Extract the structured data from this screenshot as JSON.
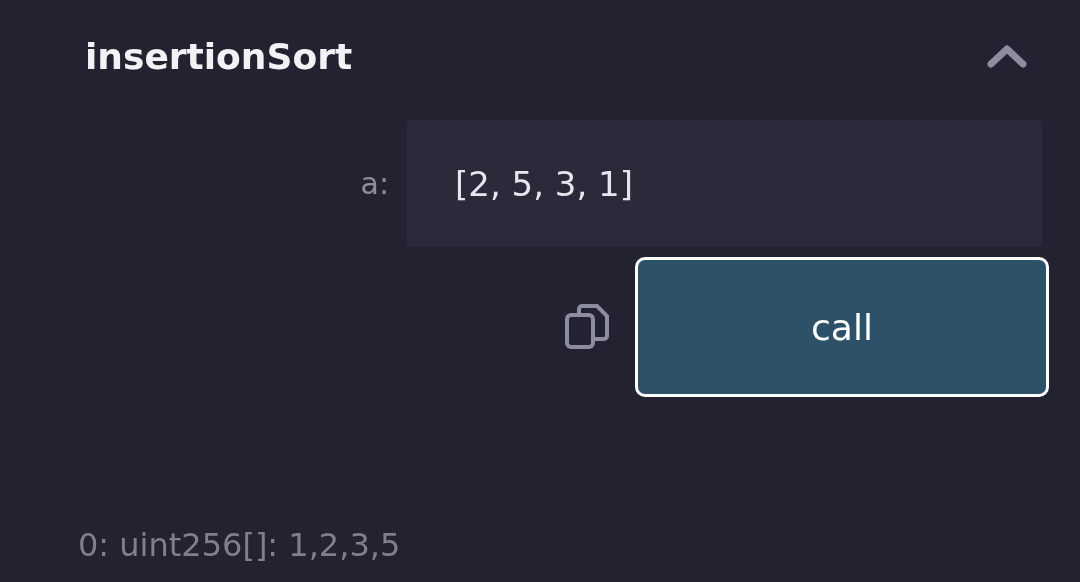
{
  "function": {
    "name": "insertionSort",
    "expanded": true,
    "inputs": [
      {
        "label": "a:",
        "value": "[2, 5, 3, 1]"
      }
    ],
    "button": "call",
    "output": "0: uint256[]: 1,2,3,5"
  }
}
